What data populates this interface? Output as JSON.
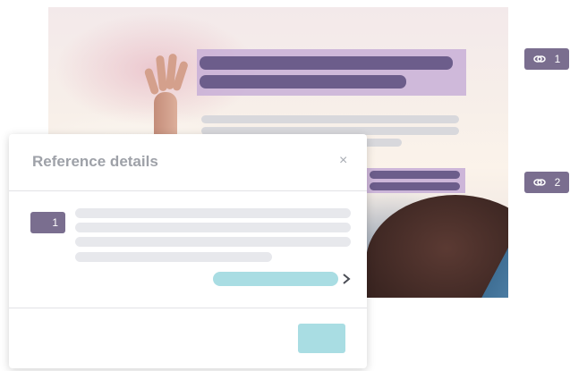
{
  "modal": {
    "title": "Reference details",
    "close_label": "×",
    "reference_number": "1"
  },
  "side_badges": [
    {
      "label": "1",
      "icon": "link-icon"
    },
    {
      "label": "2",
      "icon": "link-icon"
    }
  ],
  "colors": {
    "badge": "#7a6e8f",
    "highlight": "#c8afd7",
    "accent": "#a9dde3"
  }
}
